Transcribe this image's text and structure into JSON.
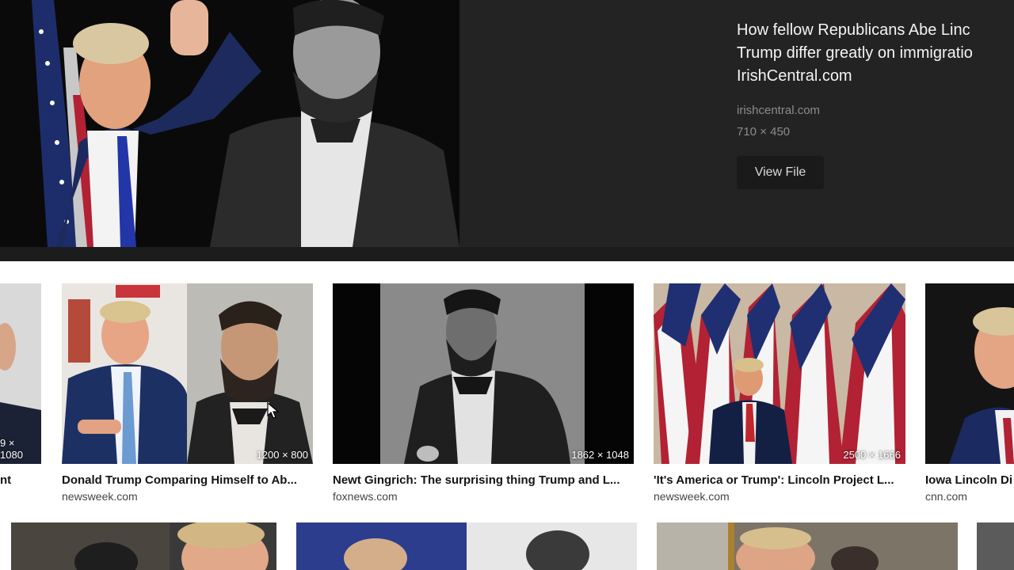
{
  "preview": {
    "title": "How fellow Republicans Abe Linc\nTrump differ greatly on immigratio\nIrishCentral.com",
    "domain": "irishcentral.com",
    "dimensions": "710 × 450",
    "view_file_label": "View File"
  },
  "results": [
    {
      "caption": "nt",
      "source": "",
      "dimensions": "9 × 1080"
    },
    {
      "caption": "Donald Trump Comparing Himself to Ab...",
      "source": "newsweek.com",
      "dimensions": "1200 × 800"
    },
    {
      "caption": "Newt Gingrich: The surprising thing Trump and L...",
      "source": "foxnews.com",
      "dimensions": "1862 × 1048"
    },
    {
      "caption": "'It's America or Trump': Lincoln Project L...",
      "source": "newsweek.com",
      "dimensions": "2500 × 1666"
    },
    {
      "caption": "Iowa Lincoln Di",
      "source": "cnn.com",
      "dimensions": ""
    }
  ]
}
